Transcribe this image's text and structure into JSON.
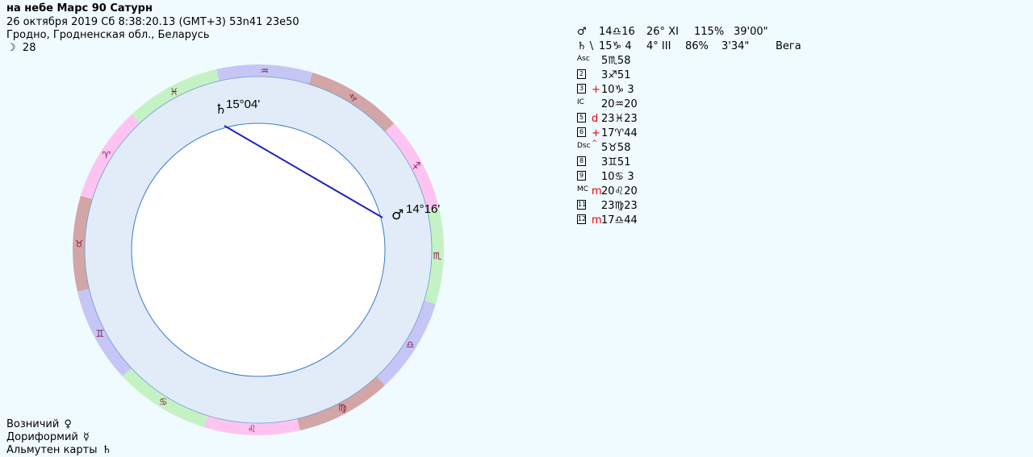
{
  "header": {
    "title": "на небе Марс 90 Сатурн",
    "line2": "26 октября 2019  Сб   8:38:20.13 (GMT+3) 53n41  23e50",
    "line3": "Гродно, Гродненская обл., Беларусь",
    "moon_symbol": "☽",
    "moon_day": "28"
  },
  "wheel": {
    "zodiac": [
      {
        "symbol": "♑",
        "color": "#d2a6a6"
      },
      {
        "symbol": "♐",
        "color": "#fdc4f2"
      },
      {
        "symbol": "♏",
        "color": "#c4f2c4"
      },
      {
        "symbol": "♎",
        "color": "#c6c6f6"
      },
      {
        "symbol": "♍",
        "color": "#d2a6a6"
      },
      {
        "symbol": "♌",
        "color": "#fdc4f2"
      },
      {
        "symbol": "♋",
        "color": "#c4f2c4"
      },
      {
        "symbol": "♊",
        "color": "#c6c6f6"
      },
      {
        "symbol": "♉",
        "color": "#d2a6a6"
      },
      {
        "symbol": "♈",
        "color": "#fdc4f2"
      },
      {
        "symbol": "♓",
        "color": "#c4f2c4"
      },
      {
        "symbol": "♒",
        "color": "#c6c6f6"
      }
    ],
    "saturn": {
      "glyph": "♄",
      "label": "15°04'"
    },
    "mars": {
      "glyph": "♂",
      "label": "14°16'"
    },
    "ring_color": "#e2ecf8",
    "aspect_color": "#2020c0"
  },
  "planets": [
    {
      "glyph": "♂",
      "pos": "14♎16",
      "house": "26° XI",
      "pct": "115%",
      "speed": "39'00\"",
      "star": ""
    },
    {
      "glyph": "♄ \\",
      "pos": "15♑ 4",
      "house": "4° III",
      "pct": "86%",
      "speed": "3'34\"",
      "star": "Вега"
    }
  ],
  "houses": [
    {
      "label": "Asc",
      "boxed": false,
      "marker": "",
      "cusp": "5♏58"
    },
    {
      "label": "2",
      "boxed": true,
      "marker": "",
      "cusp": "3♐51"
    },
    {
      "label": "3",
      "boxed": true,
      "marker": "+",
      "cusp": "10♑ 3"
    },
    {
      "label": "IC",
      "boxed": false,
      "marker": "",
      "cusp": "20♒20"
    },
    {
      "label": "5",
      "boxed": true,
      "marker": "d",
      "cusp": "23♓23"
    },
    {
      "label": "6",
      "boxed": true,
      "marker": "+",
      "cusp": "17♈44"
    },
    {
      "label": "Dsc",
      "boxed": false,
      "marker": "^",
      "cusp": "5♉58"
    },
    {
      "label": "8",
      "boxed": true,
      "marker": "",
      "cusp": "3♊51"
    },
    {
      "label": "9",
      "boxed": true,
      "marker": "",
      "cusp": "10♋ 3"
    },
    {
      "label": "MC",
      "boxed": false,
      "marker": "m",
      "cusp": "20♌20"
    },
    {
      "label": "11",
      "boxed": true,
      "marker": "",
      "cusp": "23♍23"
    },
    {
      "label": "12",
      "boxed": true,
      "marker": "m",
      "cusp": "17♎44"
    }
  ],
  "footer": [
    {
      "label": "Возничий",
      "glyph": "♀"
    },
    {
      "label": "Дориформий",
      "glyph": "☿"
    },
    {
      "label": "Альмутен карты",
      "glyph": "♄"
    }
  ]
}
